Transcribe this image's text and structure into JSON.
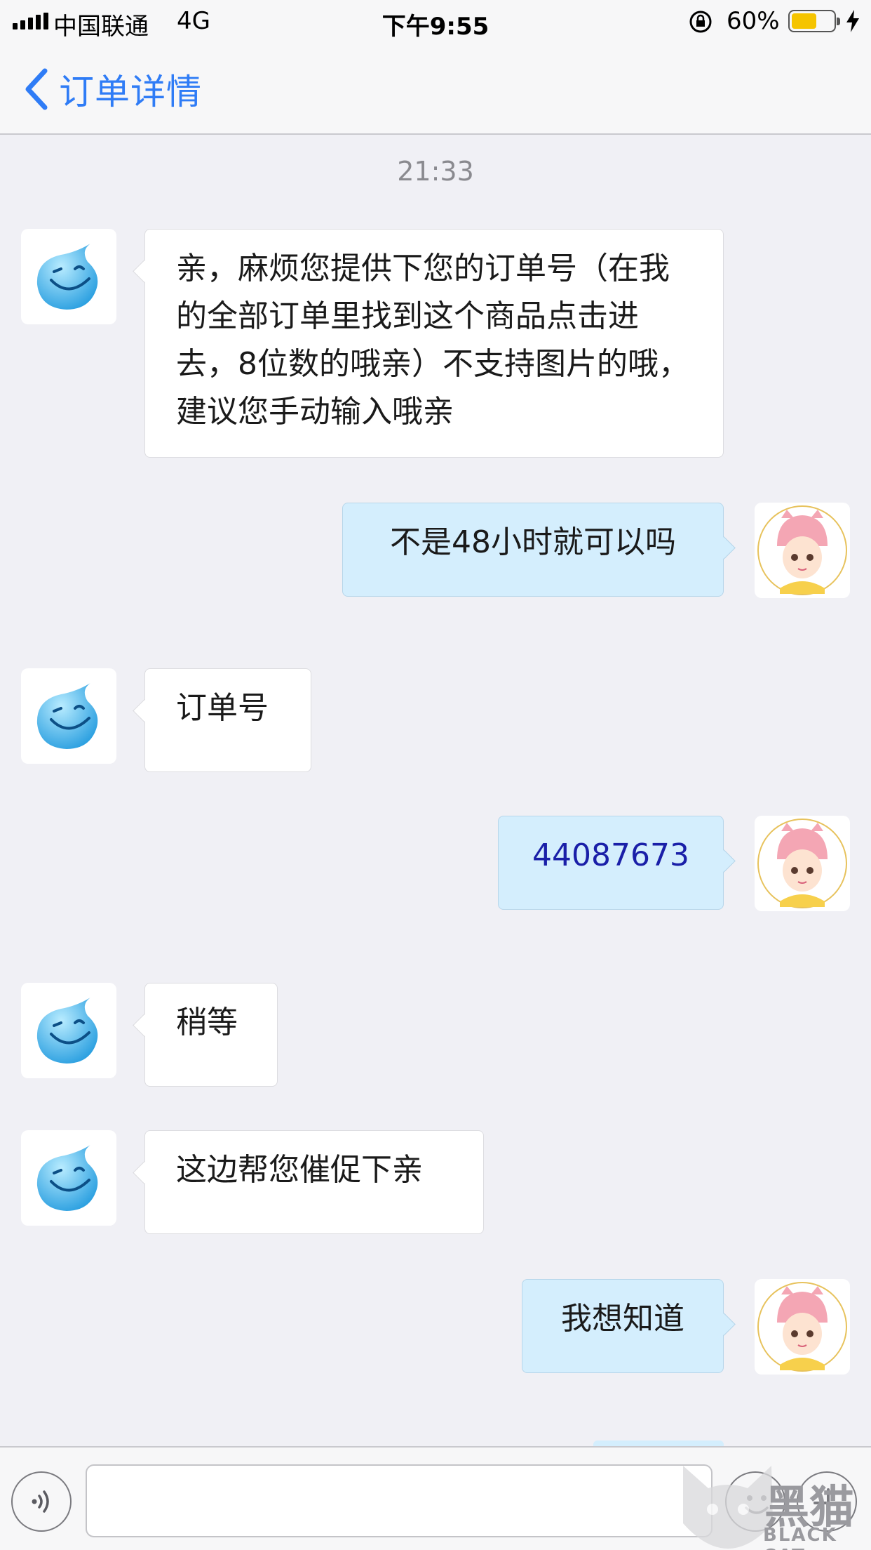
{
  "status_bar": {
    "carrier": "中国联通",
    "network": "4G",
    "time": "下午9:55",
    "battery_percent": "60%",
    "battery_level": 0.6,
    "icons": [
      "signal-icon",
      "rotation-lock-icon",
      "battery-icon",
      "charging-bolt-icon"
    ]
  },
  "nav": {
    "back_icon": "chevron-left-icon",
    "title": "订单详情"
  },
  "chat": {
    "timestamp": "21:33",
    "messages": [
      {
        "sender": "agent",
        "text": "亲，麻烦您提供下您的订单号（在我的全部订单里找到这个商品点击进去，8位数的哦亲）不支持图片的哦，建议您手动输入哦亲"
      },
      {
        "sender": "user",
        "text": "不是48小时就可以吗"
      },
      {
        "sender": "agent",
        "text": "订单号"
      },
      {
        "sender": "user",
        "text": "44087673"
      },
      {
        "sender": "agent",
        "text": "稍等"
      },
      {
        "sender": "agent",
        "text": "这边帮您催促下亲"
      },
      {
        "sender": "user",
        "text": "我想知道"
      }
    ]
  },
  "input_bar": {
    "value": "",
    "icons": [
      "voice-icon",
      "emoji-icon",
      "plus-icon"
    ]
  },
  "watermark": {
    "cn": "黑猫",
    "en": "BLACK CAT"
  },
  "colors": {
    "accent": "#2f7cf6",
    "outgoing_bubble": "#d4eefd",
    "incoming_bubble": "#ffffff",
    "background": "#f0f0f5"
  }
}
